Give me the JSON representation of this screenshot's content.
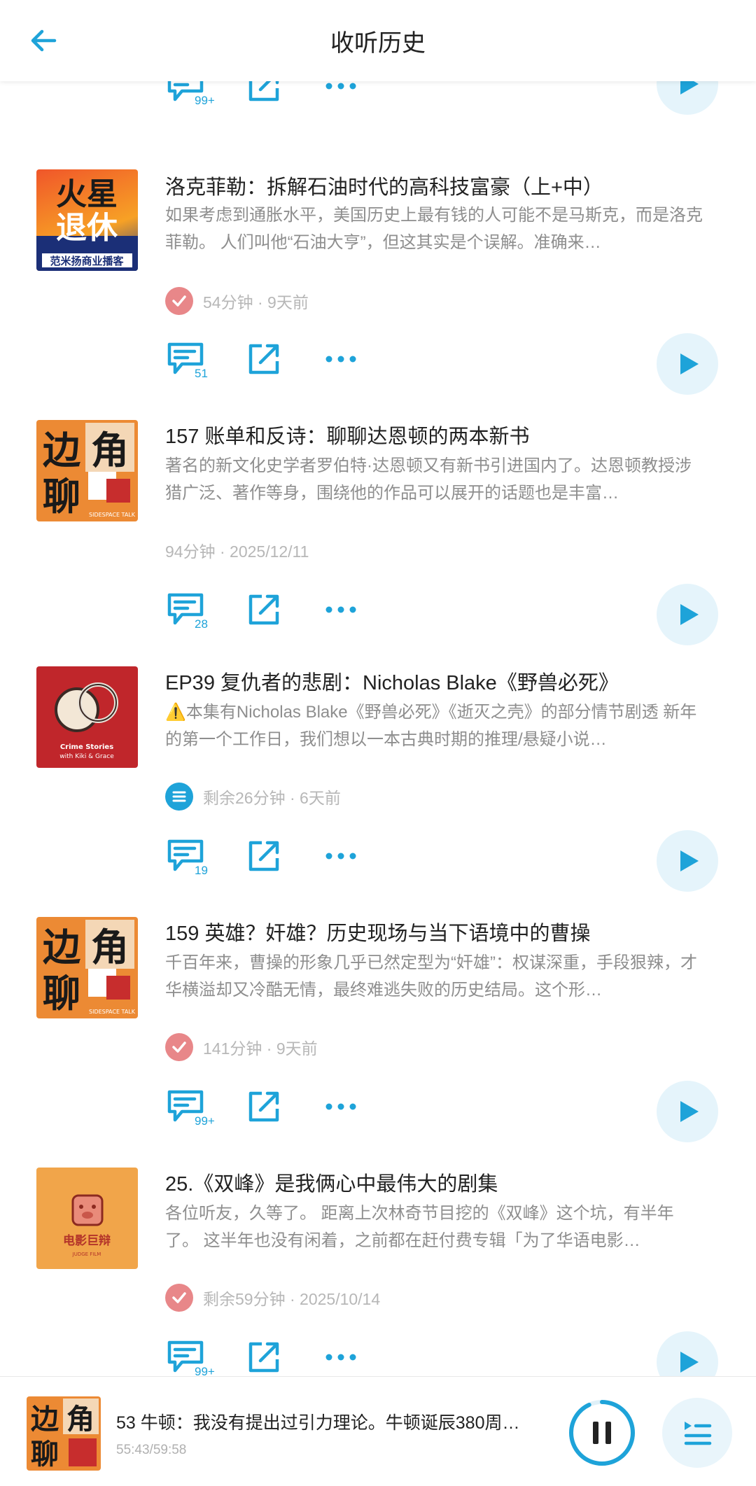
{
  "header": {
    "title": "收听历史"
  },
  "top_partial": {
    "comment_count": "99+"
  },
  "episodes": [
    {
      "title": "洛克菲勒：拆解石油时代的高科技富豪（上+中）",
      "description": "如果考虑到通胀水平，美国历史上最有钱的人可能不是马斯克，而是洛克菲勒。 人们叫他“石油大亨”，但这其实是个误解。准确来…",
      "meta": "54分钟 · 9天前",
      "status": "done",
      "comment_count": "51",
      "cover": {
        "line1": "火星",
        "line2": "退休",
        "caption": "范米扬商业播客"
      }
    },
    {
      "title": "157 账单和反诗：聊聊达恩顿的两本新书",
      "description": "著名的新文化史学者罗伯特·达恩顿又有新书引进国内了。达恩顿教授涉猎广泛、著作等身，围绕他的作品可以展开的话题也是丰富…",
      "meta": "94分钟 · 2025/12/11",
      "status": "none",
      "comment_count": "28",
      "cover": {
        "chars": [
          "边",
          "角",
          "聊"
        ],
        "tag": "SIDESPACE TALK"
      }
    },
    {
      "title": "EP39 复仇者的悲剧：Nicholas Blake《野兽必死》",
      "description": "⚠️本集有Nicholas Blake《野兽必死》《逝灭之壳》的部分情节剧透 新年的第一个工作日，我们想以一本古典时期的推理/悬疑小说…",
      "meta": "剩余26分钟 · 6天前",
      "status": "list",
      "comment_count": "19",
      "cover": {
        "line1": "Crime Stories",
        "line2": "with Kiki & Grace"
      }
    },
    {
      "title": "159 英雄？奸雄？历史现场与当下语境中的曹操",
      "description": "千百年来，曹操的形象几乎已然定型为“奸雄”：权谋深重，手段狠辣，才华横溢却又冷酷无情，最终难逃失败的历史结局。这个形…",
      "meta": "141分钟 · 9天前",
      "status": "done",
      "comment_count": "99+",
      "cover": {
        "chars": [
          "边",
          "角",
          "聊"
        ],
        "tag": "SIDESPACE TALK"
      }
    },
    {
      "title": "25.《双峰》是我俩心中最伟大的剧集",
      "description": "各位听友，久等了。 距离上次林奇节目挖的《双峰》这个坑，有半年了。 这半年也没有闲着，之前都在赶付费专辑「为了华语电影…",
      "meta": "剩余59分钟 · 2025/10/14",
      "status": "done",
      "comment_count": "99+",
      "cover": {
        "line1": "电影巨辩",
        "line2": "JUDGE FILM"
      }
    }
  ],
  "player": {
    "title": "53 牛顿：我没有提出过引力理论。牛顿诞辰380周…",
    "time": "55:43/59:58",
    "progress": 0.93,
    "cover": {
      "chars": [
        "边",
        "角",
        "聊"
      ]
    }
  },
  "colors": {
    "accent": "#1ea3d9",
    "done": "#e88789",
    "play_bg": "#e5f4fb"
  }
}
